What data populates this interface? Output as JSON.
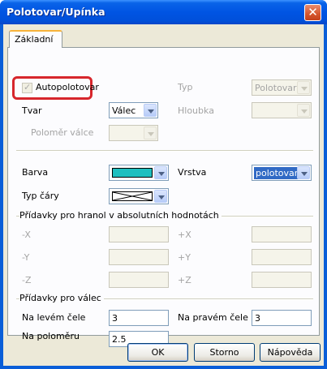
{
  "window": {
    "title": "Polotovar/Upínka"
  },
  "tabs": [
    {
      "label": "Základní"
    }
  ],
  "section1": {
    "auto_checkbox": {
      "label": "Autopolotovar",
      "checked": true
    },
    "typ": {
      "label": "Typ",
      "value": "Polotovar"
    },
    "tvar": {
      "label": "Tvar",
      "value": "Válec"
    },
    "hloubka": {
      "label": "Hloubka",
      "value": ""
    },
    "polomer_valce": {
      "label": "Poloměr válce",
      "value": ""
    }
  },
  "section2": {
    "barva": {
      "label": "Barva",
      "color": "#1fbfbf"
    },
    "vrstva": {
      "label": "Vrstva",
      "value": "polotovar"
    },
    "typ_cary": {
      "label": "Typ čáry"
    }
  },
  "hranol": {
    "group_label": "Přídavky pro hranol v absolutních hodnotách",
    "minus_x": {
      "label": "-X",
      "value": ""
    },
    "plus_x": {
      "label": "+X",
      "value": ""
    },
    "minus_y": {
      "label": "-Y",
      "value": ""
    },
    "plus_y": {
      "label": "+Y",
      "value": ""
    },
    "minus_z": {
      "label": "-Z",
      "value": ""
    },
    "plus_z": {
      "label": "+Z",
      "value": ""
    }
  },
  "valec": {
    "group_label": "Přídavky pro válec",
    "levem_cele": {
      "label": "Na levém čele",
      "value": "3"
    },
    "pravem_cele": {
      "label": "Na pravém čele",
      "value": "3"
    },
    "polomeru": {
      "label": "Na poloměru",
      "value": "2.5"
    }
  },
  "buttons": {
    "ok": "OK",
    "storno": "Storno",
    "napoveda": "Nápověda"
  },
  "colors": {
    "title_bar": "#0054e3",
    "dialog_bg": "#ece9d8",
    "highlight": "#d7262c",
    "selection": "#316ac5"
  }
}
